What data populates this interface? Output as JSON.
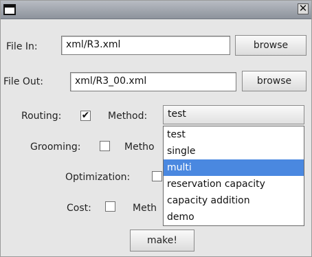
{
  "form": {
    "file_in_label": "File In:",
    "file_in_value": "xml/R3.xml",
    "browse_label": "browse",
    "file_out_label": "File Out:",
    "file_out_value": "xml/R3_00.xml",
    "routing_label": "Routing:",
    "routing_checked": true,
    "method_label": "Method:",
    "method_value": "test",
    "grooming_label": "Grooming:",
    "grooming_checked": false,
    "grooming_method_label": "Metho",
    "optimization_label": "Optimization:",
    "optimization_checked": false,
    "cost_label": "Cost:",
    "cost_checked": false,
    "cost_method_label": "Meth",
    "make_label": "make!"
  },
  "dropdown": {
    "options": [
      "test",
      "single",
      "multi",
      "reservation capacity",
      "capacity addition",
      "demo"
    ],
    "highlighted": "multi"
  },
  "icons": {
    "window_icon": "window-menu-icon",
    "close_icon": "close-icon",
    "checkmark": "✔"
  },
  "colors": {
    "selection": "#4a88e0",
    "titlebar": "#a3a8b0"
  }
}
